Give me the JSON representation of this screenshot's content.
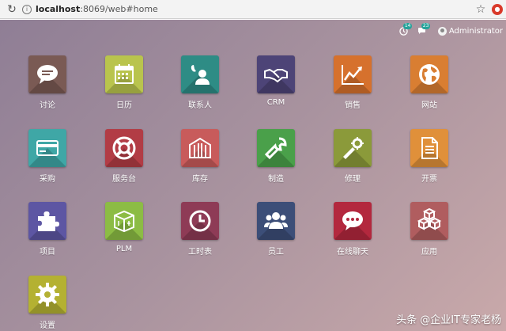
{
  "browser": {
    "url_host": "localhost",
    "url_path": ":8069/web#home",
    "ext_label": "●"
  },
  "systray": {
    "activity_count": "14",
    "messages_count": "23",
    "user_name": "Administrator"
  },
  "apps": [
    {
      "label": "讨论",
      "icon": "chat-icon",
      "color": "#7a5a54"
    },
    {
      "label": "日历",
      "icon": "calendar-icon",
      "color": "#b9c44d"
    },
    {
      "label": "联系人",
      "icon": "contacts-icon",
      "color": "#2e8c85"
    },
    {
      "label": "CRM",
      "icon": "handshake-icon",
      "color": "#4d4477"
    },
    {
      "label": "销售",
      "icon": "sales-chart-icon",
      "color": "#d6712d"
    },
    {
      "label": "网站",
      "icon": "globe-icon",
      "color": "#d97e32"
    },
    {
      "label": "采购",
      "icon": "credit-card-icon",
      "color": "#3fa7a6"
    },
    {
      "label": "服务台",
      "icon": "lifebuoy-icon",
      "color": "#b23c45"
    },
    {
      "label": "库存",
      "icon": "warehouse-icon",
      "color": "#c85b5b"
    },
    {
      "label": "制造",
      "icon": "wrench-icon",
      "color": "#4aa04a"
    },
    {
      "label": "修理",
      "icon": "tools-icon",
      "color": "#8b9a3a"
    },
    {
      "label": "开票",
      "icon": "invoice-icon",
      "color": "#e0903a"
    },
    {
      "label": "项目",
      "icon": "puzzle-icon",
      "color": "#5d56a3"
    },
    {
      "label": "PLM",
      "icon": "plm-box-icon",
      "color": "#8cbc44"
    },
    {
      "label": "工时表",
      "icon": "clock-icon",
      "color": "#8e3b56"
    },
    {
      "label": "员工",
      "icon": "employees-icon",
      "color": "#3c4e78"
    },
    {
      "label": "在线聊天",
      "icon": "live-chat-icon",
      "color": "#b3283e"
    },
    {
      "label": "应用",
      "icon": "cubes-icon",
      "color": "#b05d5f"
    },
    {
      "label": "设置",
      "icon": "gear-icon",
      "color": "#b4b132"
    }
  ],
  "watermark": "头条 @企业IT专家老杨"
}
